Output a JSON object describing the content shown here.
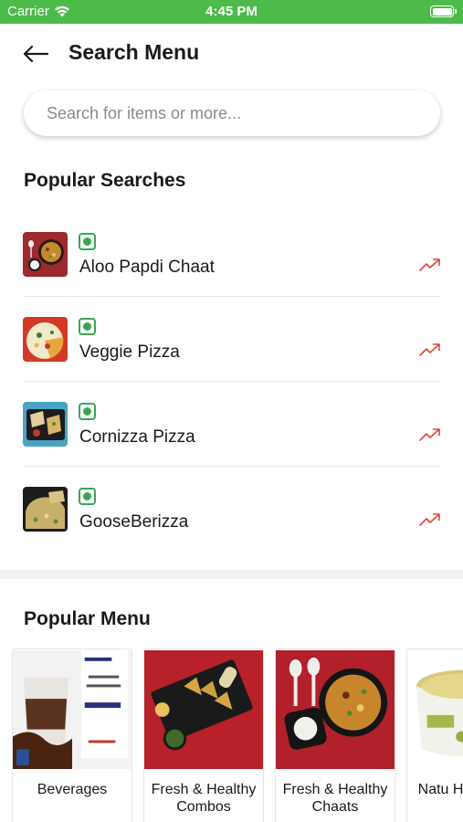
{
  "status_bar": {
    "carrier": "Carrier",
    "time": "4:45 PM"
  },
  "header": {
    "title": "Search Menu"
  },
  "search": {
    "placeholder": "Search for items or more..."
  },
  "popular_searches": {
    "title": "Popular Searches",
    "items": [
      {
        "name": "Aloo Papdi Chaat"
      },
      {
        "name": "Veggie Pizza"
      },
      {
        "name": "Cornizza Pizza"
      },
      {
        "name": "GooseBerizza"
      }
    ]
  },
  "popular_menu": {
    "title": "Popular Menu",
    "cards": [
      {
        "label": "Beverages"
      },
      {
        "label": "Fresh & Healthy Combos"
      },
      {
        "label": "Fresh & Healthy Chaats"
      },
      {
        "label": "Natu Healt Gro"
      }
    ]
  },
  "colors": {
    "status_bar": "#4cbb4a",
    "veg": "#3aa655",
    "trend": "#e0453a"
  }
}
